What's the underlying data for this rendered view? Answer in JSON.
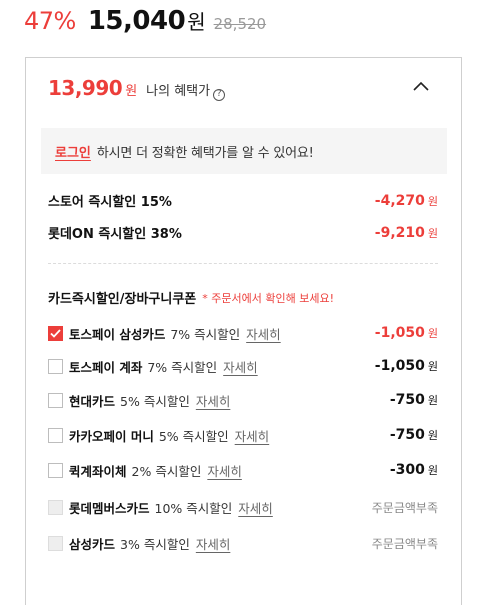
{
  "price": {
    "discount_rate": "47%",
    "sale_price": "15,040",
    "sale_unit": "원",
    "original_price": "28,520"
  },
  "benefit": {
    "price": "13,990",
    "unit": "원",
    "label": "나의 혜택가",
    "info_icon": "question-circle-icon",
    "collapse_icon": "chevron-up-icon"
  },
  "login_notice": {
    "link": "로그인",
    "text": "하시면 더 정확한 혜택가를 알 수 있어요!"
  },
  "instant_discounts": [
    {
      "label": "스토어 즉시할인 15%",
      "amount": "-4,270",
      "unit": "원"
    },
    {
      "label": "롯데ON 즉시할인 38%",
      "amount": "-9,210",
      "unit": "원"
    }
  ],
  "card_section": {
    "title": "카드즉시할인/장바구니쿠폰",
    "note": "* 주문서에서 확인해 보세요!"
  },
  "card_discounts": [
    {
      "name": "토스페이 삼성카드",
      "discount": "7% 즉시할인",
      "detail": "자세히",
      "amount": "-1,050",
      "unit": "원",
      "status": "",
      "state": "checked"
    },
    {
      "name": "토스페이 계좌",
      "discount": "7% 즉시할인",
      "detail": "자세히",
      "amount": "-1,050",
      "unit": "원",
      "status": "",
      "state": "unchecked"
    },
    {
      "name": "현대카드",
      "discount": "5% 즉시할인",
      "detail": "자세히",
      "amount": "-750",
      "unit": "원",
      "status": "",
      "state": "unchecked"
    },
    {
      "name": "카카오페이 머니",
      "discount": "5% 즉시할인",
      "detail": "자세히",
      "amount": "-750",
      "unit": "원",
      "status": "",
      "state": "unchecked"
    },
    {
      "name": "퀵계좌이체",
      "discount": "2% 즉시할인",
      "detail": "자세히",
      "amount": "-300",
      "unit": "원",
      "status": "",
      "state": "unchecked"
    },
    {
      "name": "롯데멤버스카드",
      "discount": "10% 즉시할인",
      "detail": "자세히",
      "amount": "",
      "unit": "",
      "status": "주문금액부족",
      "state": "disabled"
    },
    {
      "name": "삼성카드",
      "discount": "3% 즉시할인",
      "detail": "자세히",
      "amount": "",
      "unit": "",
      "status": "주문금액부족",
      "state": "disabled"
    }
  ],
  "colors": {
    "accent": "#ec3e3a",
    "border": "#cfcfcf",
    "notice_bg": "#f5f5f5"
  }
}
